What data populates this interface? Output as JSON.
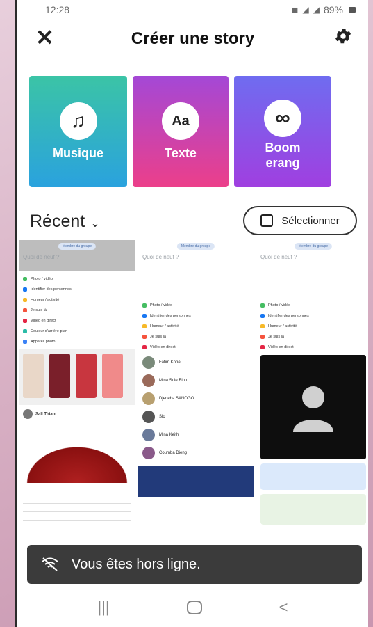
{
  "status_bar": {
    "time": "12:28",
    "battery": "89%"
  },
  "header": {
    "title": "Créer une story"
  },
  "tiles": [
    {
      "id": "music",
      "label": "Musique",
      "icon_text": "♫"
    },
    {
      "id": "text",
      "label": "Texte",
      "icon_text": "Aa"
    },
    {
      "id": "boom",
      "label_line1": "Boom",
      "label_line2": "erang",
      "icon_text": "∞"
    }
  ],
  "recent": {
    "label": "Récent",
    "select_label": "Sélectionner"
  },
  "gallery": {
    "pill": "Membre du groupe",
    "placeholder": "Quoi de neuf ?",
    "options": [
      {
        "label": "Photo / vidéo",
        "color": "#45bd62"
      },
      {
        "label": "Identifier des personnes",
        "color": "#1877f2"
      },
      {
        "label": "Humeur / activité",
        "color": "#f7b928"
      },
      {
        "label": "Je suis là",
        "color": "#f5533d"
      },
      {
        "label": "Vidéo en direct",
        "color": "#e42645"
      },
      {
        "label": "Couleur d'arrière-plan",
        "color": "#2abba7"
      },
      {
        "label": "Appareil photo",
        "color": "#3b82f6"
      }
    ],
    "contacts": [
      "Fatim Kone",
      "Mina Sule Bintu",
      "Djenéba SANOGO",
      "Sio",
      "Mina Keith",
      "Coumba Dieng"
    ],
    "post_author": "Sall Thiam"
  },
  "toast": {
    "message": "Vous êtes hors ligne."
  },
  "nav": {
    "recents": "|||",
    "back": "<"
  }
}
